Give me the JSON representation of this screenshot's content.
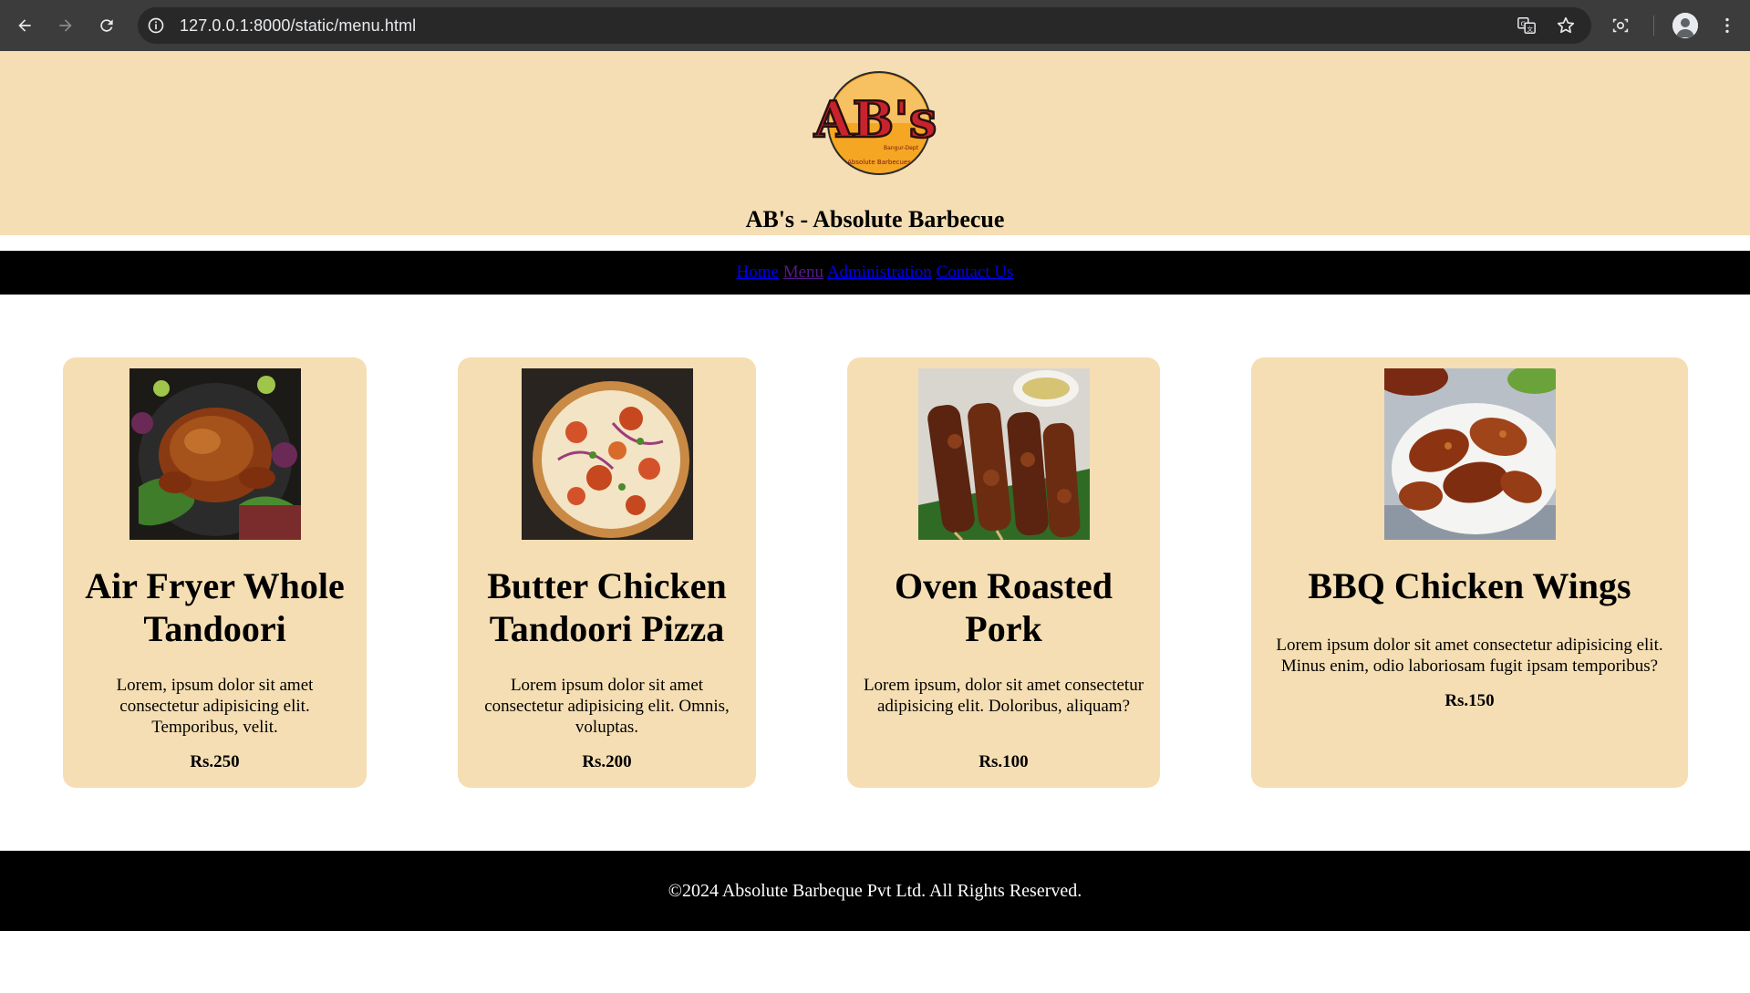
{
  "browser": {
    "url": "127.0.0.1:8000/static/menu.html"
  },
  "header": {
    "title": "AB's - Absolute Barbecue",
    "logo_text": "AB's",
    "logo_tagline": "Absolute Barbecues",
    "logo_sub": "Bangur-Dept"
  },
  "nav": {
    "items": [
      {
        "label": "Home"
      },
      {
        "label": "Menu"
      },
      {
        "label": "Administration"
      },
      {
        "label": "Contact Us"
      }
    ]
  },
  "menu": {
    "items": [
      {
        "name": "Air Fryer Whole Tandoori",
        "description": "Lorem, ipsum dolor sit amet consectetur adipisicing elit. Temporibus, velit.",
        "price": "Rs.250",
        "image_icon": "roast-chicken-photo"
      },
      {
        "name": "Butter Chicken Tandoori Pizza",
        "description": "Lorem ipsum dolor sit amet consectetur adipisicing elit. Omnis, voluptas.",
        "price": "Rs.200",
        "image_icon": "pizza-photo"
      },
      {
        "name": "Oven Roasted Pork",
        "description": "Lorem ipsum, dolor sit amet consectetur adipisicing elit. Doloribus, aliquam?",
        "price": "Rs.100",
        "image_icon": "pork-skewers-photo"
      },
      {
        "name": "BBQ Chicken Wings",
        "description": "Lorem ipsum dolor sit amet consectetur adipisicing elit. Minus enim, odio laboriosam fugit ipsam temporibus?",
        "price": "Rs.150",
        "image_icon": "chicken-wings-photo"
      }
    ]
  },
  "footer": {
    "text": "©2024 Absolute Barbeque Pvt Ltd. All Rights Reserved."
  },
  "colors": {
    "header_bg": "#f5deb3",
    "card_bg": "#f5deb3",
    "nav_bg": "#000000",
    "link": "#0000ee",
    "visited_link": "#551a8b"
  }
}
